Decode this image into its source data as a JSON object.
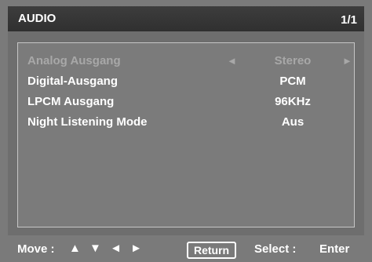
{
  "header": {
    "title": "AUDIO",
    "page": "1/1"
  },
  "menu": {
    "items": [
      {
        "label": "Analog Ausgang",
        "value": "Stereo",
        "left_arrow": "◄",
        "right_arrow": "►",
        "state": "disabled"
      },
      {
        "label": "Digital-Ausgang",
        "value": "PCM"
      },
      {
        "label": "LPCM Ausgang",
        "value": "96KHz"
      },
      {
        "label": "Night Listening Mode",
        "value": "Aus"
      }
    ]
  },
  "footer": {
    "move_label": "Move :",
    "move_icons": [
      "▲",
      "▼",
      "◄",
      "►"
    ],
    "return_label": "Return",
    "select_label": "Select :",
    "enter_label": "Enter"
  },
  "colors": {
    "background": "#7a7a7a",
    "header_bg": "#333333",
    "text": "#ffffff",
    "disabled_text": "#a8a8a8",
    "panel_border": "#c5c5c5"
  }
}
